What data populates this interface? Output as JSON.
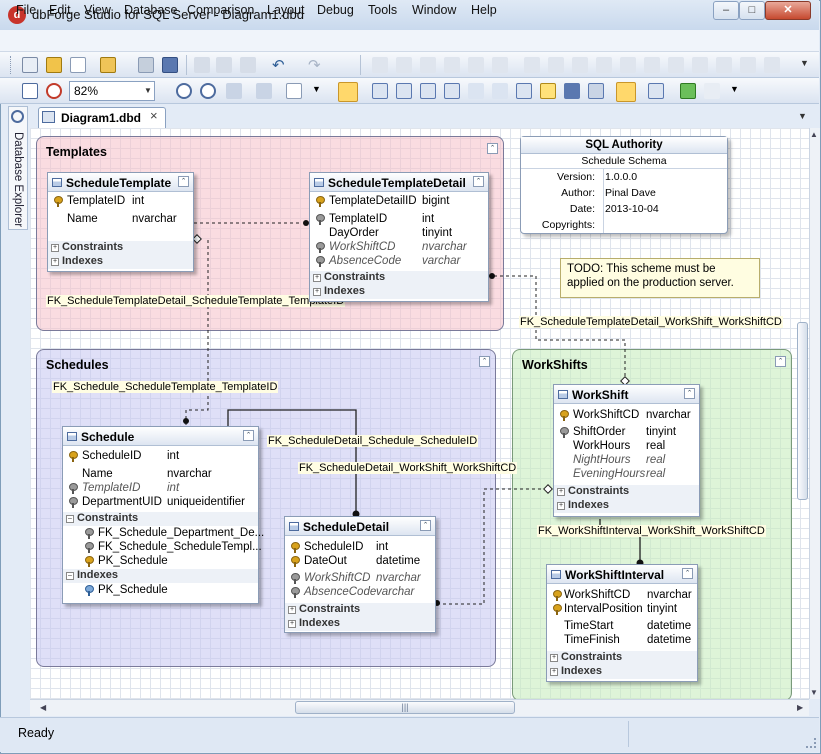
{
  "window": {
    "title": "dbForge Studio for SQL Server - Diagram1.dbd",
    "app_icon": "dbforge-logo-icon"
  },
  "menu": [
    "File",
    "Edit",
    "View",
    "Database",
    "Comparison",
    "Layout",
    "Debug",
    "Tools",
    "Window",
    "Help"
  ],
  "toolbar": {
    "zoom": "82%"
  },
  "sidebar": {
    "label": "Database Explorer"
  },
  "tab": {
    "label": "Diagram1.dbd",
    "close": "×"
  },
  "containers": {
    "templates": "Templates",
    "schedules": "Schedules",
    "workshifts": "WorkShifts"
  },
  "entities": {
    "schedule_template": {
      "title": "ScheduleTemplate",
      "rows": [
        [
          "TemplateID",
          "int"
        ],
        [
          "Name",
          "nvarchar"
        ]
      ],
      "sections": [
        "Constraints",
        "Indexes"
      ]
    },
    "schedule_template_detail": {
      "title": "ScheduleTemplateDetail",
      "rows": [
        [
          "TemplateDetailID",
          "bigint"
        ],
        [
          "TemplateID",
          "int"
        ],
        [
          "DayOrder",
          "tinyint"
        ],
        [
          "WorkShiftCD",
          "nvarchar"
        ],
        [
          "AbsenceCode",
          "varchar"
        ]
      ],
      "sections": [
        "Constraints",
        "Indexes"
      ]
    },
    "schedule": {
      "title": "Schedule",
      "rows": [
        [
          "ScheduleID",
          "int"
        ],
        [
          "Name",
          "nvarchar"
        ],
        [
          "TemplateID",
          "int"
        ],
        [
          "DepartmentUID",
          "uniqueidentifier"
        ]
      ],
      "constraints": [
        "FK_Schedule_Department_De...",
        "FK_Schedule_ScheduleTempl...",
        "PK_Schedule"
      ],
      "indexes": [
        "PK_Schedule"
      ],
      "sections": [
        "Constraints",
        "Indexes"
      ]
    },
    "schedule_detail": {
      "title": "ScheduleDetail",
      "rows": [
        [
          "ScheduleID",
          "int"
        ],
        [
          "DateOut",
          "datetime"
        ],
        [
          "WorkShiftCD",
          "nvarchar"
        ],
        [
          "AbsenceCode",
          "varchar"
        ]
      ],
      "sections": [
        "Constraints",
        "Indexes"
      ]
    },
    "workshift": {
      "title": "WorkShift",
      "rows": [
        [
          "WorkShiftCD",
          "nvarchar"
        ],
        [
          "ShiftOrder",
          "tinyint"
        ],
        [
          "WorkHours",
          "real"
        ],
        [
          "NightHours",
          "real"
        ],
        [
          "EveningHours",
          "real"
        ]
      ],
      "sections": [
        "Constraints",
        "Indexes"
      ]
    },
    "workshift_interval": {
      "title": "WorkShiftInterval",
      "rows": [
        [
          "WorkShiftCD",
          "nvarchar"
        ],
        [
          "IntervalPosition",
          "tinyint"
        ],
        [
          "TimeStart",
          "datetime"
        ],
        [
          "TimeFinish",
          "datetime"
        ]
      ],
      "sections": [
        "Constraints",
        "Indexes"
      ]
    }
  },
  "relations": {
    "fk1": "FK_ScheduleTemplateDetail_ScheduleTemplate_TemplateID",
    "fk2": "FK_ScheduleTemplateDetail_WorkShift_WorkShiftCD",
    "fk3": "FK_Schedule_ScheduleTemplate_TemplateID",
    "fk4": "FK_ScheduleDetail_Schedule_ScheduleID",
    "fk5": "FK_ScheduleDetail_WorkShift_WorkShiftCD",
    "fk6": "FK_WorkShiftInterval_WorkShift_WorkShiftCD"
  },
  "authority": {
    "title": "SQL Authority",
    "subtitle": "Schedule Schema",
    "keys": [
      "Version:",
      "Author:",
      "Date:",
      "Copyrights:"
    ],
    "values": [
      "1.0.0.0",
      "Pinal Dave",
      "2013-10-04",
      ""
    ]
  },
  "note": {
    "text": "TODO: This scheme must be applied on the production server."
  },
  "status": {
    "text": "Ready"
  },
  "colors": {
    "templates": "#fbe3e6",
    "schedules": "#e2e2f8",
    "workshifts": "#e2f5dd",
    "accent": "#4d6b9e"
  }
}
